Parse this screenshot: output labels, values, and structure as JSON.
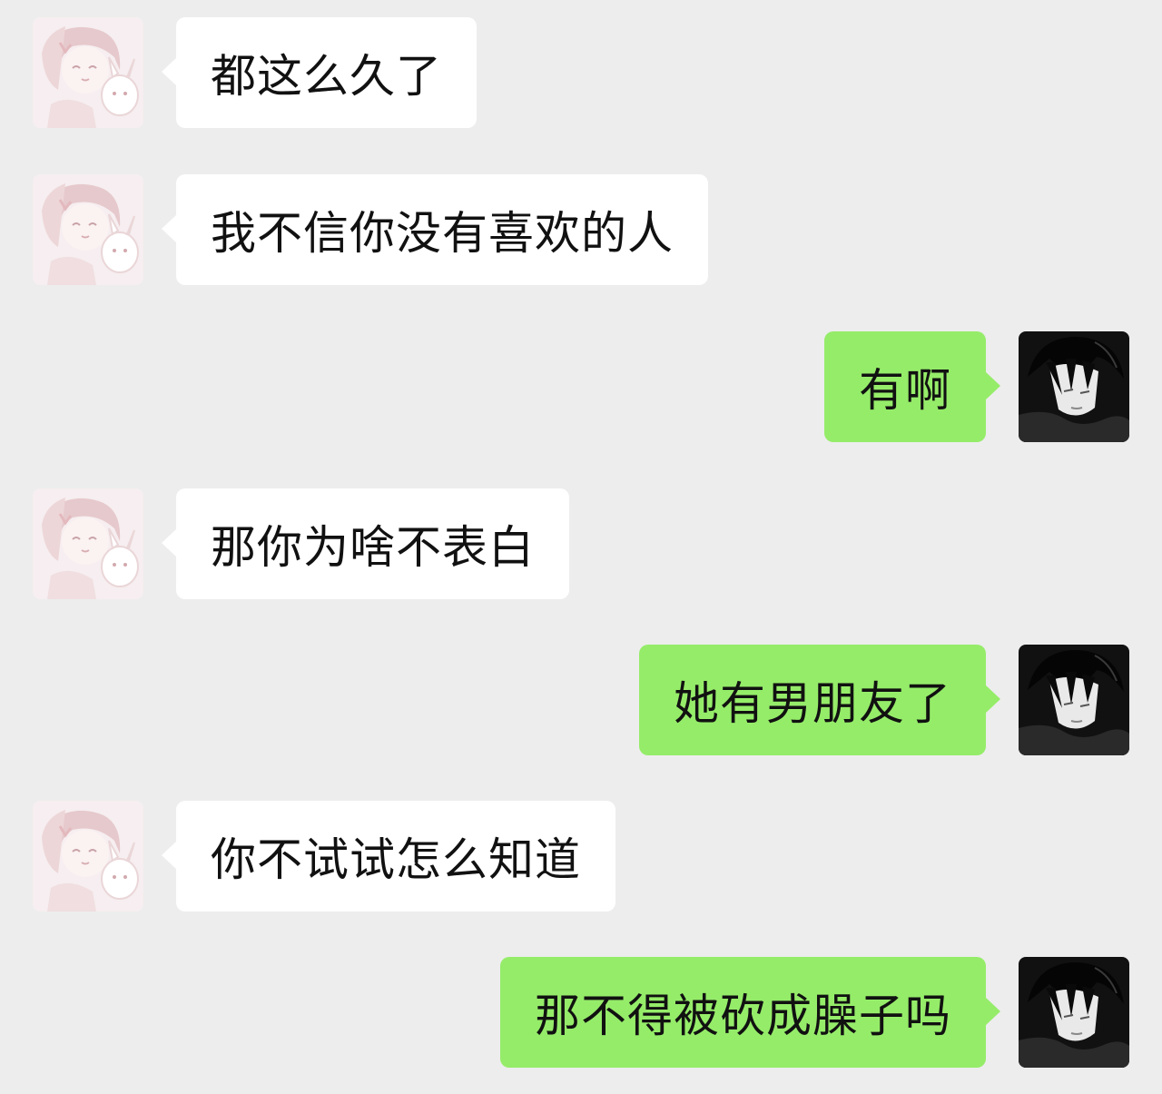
{
  "messages": [
    {
      "side": "in",
      "text": "都这么久了",
      "avatar": "anime-girl-bunny-avatar"
    },
    {
      "side": "in",
      "text": "我不信你没有喜欢的人",
      "avatar": "anime-girl-bunny-avatar"
    },
    {
      "side": "out",
      "text": "有啊",
      "avatar": "dark-hair-boy-avatar"
    },
    {
      "side": "in",
      "text": "那你为啥不表白",
      "avatar": "anime-girl-bunny-avatar"
    },
    {
      "side": "out",
      "text": "她有男朋友了",
      "avatar": "dark-hair-boy-avatar"
    },
    {
      "side": "in",
      "text": "你不试试怎么知道",
      "avatar": "anime-girl-bunny-avatar"
    },
    {
      "side": "out",
      "text": "那不得被砍成臊子吗",
      "avatar": "dark-hair-boy-avatar"
    }
  ],
  "colors": {
    "background": "#ededed",
    "incoming_bubble": "#ffffff",
    "outgoing_bubble": "#95ec69"
  }
}
